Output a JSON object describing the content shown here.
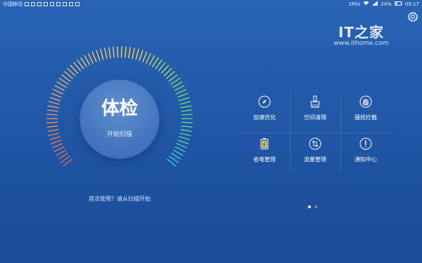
{
  "status_bar": {
    "carrier": "中国移动",
    "speed": "2M/s",
    "battery": "24%",
    "time": "09:17"
  },
  "watermark": {
    "logo": "IT之家",
    "url": "www.ithome.com"
  },
  "scan": {
    "title": "体检",
    "button_label": "开始扫描",
    "hint": "首次使用？请从扫描开始"
  },
  "grid": {
    "items": [
      {
        "label": "加速优化",
        "icon": "compass-icon"
      },
      {
        "label": "空间清理",
        "icon": "brush-icon"
      },
      {
        "label": "骚扰拦截",
        "icon": "hand-icon"
      },
      {
        "label": "省电管理",
        "icon": "battery-icon"
      },
      {
        "label": "流量管理",
        "icon": "data-arrows-icon"
      },
      {
        "label": "通知中心",
        "icon": "exclamation-icon"
      }
    ]
  },
  "pager": {
    "pages": 2,
    "active": 1
  },
  "colors": {
    "bg_top": "#2a64b4",
    "bg_bottom": "#1a4b96"
  }
}
